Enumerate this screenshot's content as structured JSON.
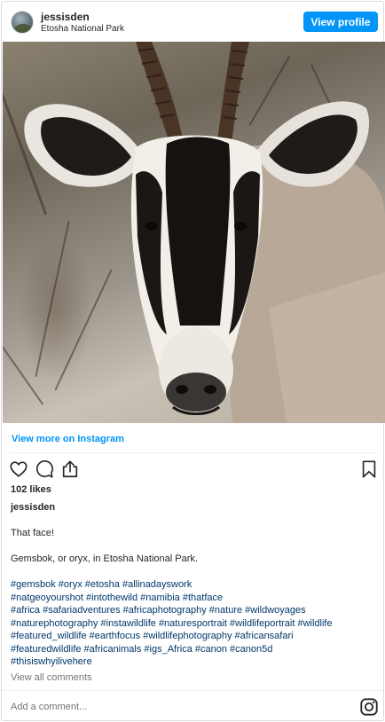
{
  "post": {
    "username": "jessisden",
    "location": "Etosha National Park",
    "view_profile_label": "View profile",
    "view_more_label": "View more on Instagram",
    "likes": "102 likes",
    "caption_user": "jessisden",
    "caption_line1": "That face!",
    "caption_line2": "Gemsbok, or oryx, in Etosha National Park.",
    "hashtag_lines": [
      "#gemsbok #oryx #etosha #allinadayswork",
      "#natgeoyourshot #intothewild #namibia #thatface",
      "#africa #safariadventures #africaphotography #nature #wildwoyages",
      "#naturephotography #instawildlife #naturesportrait #wildlifeportrait #wildlife",
      "#featured_wildlife #earthfocus #wildlifephotography #africansafari",
      "#featuredwildlife #africanimals #igs_Africa #canon #canon5d",
      "#thisiswhyilivehere"
    ],
    "view_comments_label": "View all comments",
    "comment_placeholder": "Add a comment..."
  },
  "icons": {
    "like": "heart-icon",
    "comment": "comment-icon",
    "share": "share-icon",
    "save": "bookmark-icon",
    "brand": "instagram-icon"
  },
  "colors": {
    "accent": "#0095f6",
    "hashtag": "#00376b",
    "muted": "#737373"
  }
}
